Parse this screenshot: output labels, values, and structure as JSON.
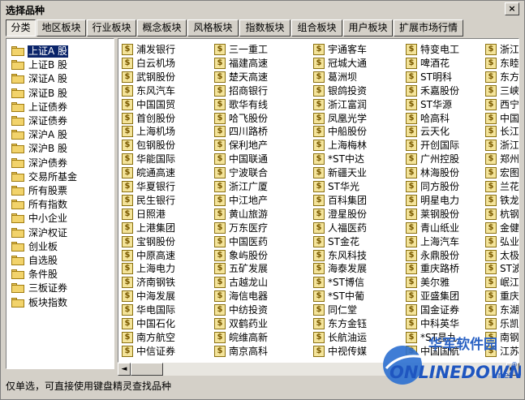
{
  "window": {
    "title": "选择品种",
    "close_label": "×"
  },
  "tabs": [
    "分类",
    "地区板块",
    "行业板块",
    "概念板块",
    "风格板块",
    "指数板块",
    "组合板块",
    "用户板块",
    "扩展市场行情"
  ],
  "tree": {
    "selected_index": 0,
    "items": [
      "上证A 股",
      "上证B 股",
      "深证A 股",
      "深证B 股",
      "上证债券",
      "深证债券",
      "深沪A 股",
      "深沪B 股",
      "深沪债券",
      "交易所基金",
      "所有股票",
      "所有指数",
      "中小企业",
      "深沪权证",
      "创业板",
      "自选股",
      "条件股",
      "三板证券",
      "板块指数"
    ]
  },
  "stock_icon": "dollar-coin-icon",
  "stock_icon_glyph": "$",
  "grid": {
    "columns": [
      [
        "浦发银行",
        "白云机场",
        "武钢股份",
        "东风汽车",
        "中国国贸",
        "首创股份",
        "上海机场",
        "包钢股份",
        "华能国际",
        "皖通高速",
        "华夏银行",
        "民生银行",
        "日照港",
        "上港集团",
        "宝钢股份",
        "中原高速",
        "上海电力",
        "济南钢铁",
        "中海发展",
        "华电国际",
        "中国石化",
        "南方航空",
        "中信证券"
      ],
      [
        "三一重工",
        "福建高速",
        "楚天高速",
        "招商银行",
        "歌华有线",
        "哈飞股份",
        "四川路桥",
        "保利地产",
        "中国联通",
        "宁波联合",
        "浙江广厦",
        "中江地产",
        "黄山旅游",
        "万东医疗",
        "中国医药",
        "象屿股份",
        "五矿发展",
        "古越龙山",
        "海信电器",
        "中纺投资",
        "双鹤药业",
        "皖维高新",
        "南京高科"
      ],
      [
        "宇通客车",
        "冠城大通",
        "葛洲坝",
        "银鸽投资",
        "浙江富润",
        "凤凰光学",
        "中船股份",
        "上海梅林",
        "*ST中达",
        "新疆天业",
        "ST华光",
        "百科集团",
        "澄星股份",
        "人福医药",
        "ST金花",
        "东风科技",
        "海泰发展",
        "*ST博信",
        "*ST中葡",
        "同仁堂",
        "东方金钰",
        "长航油运",
        "中视传媒"
      ],
      [
        "特变电工",
        "啤酒花",
        "ST明科",
        "禾嘉股份",
        "ST华源",
        "哈高科",
        "云天化",
        "开创国际",
        "广州控股",
        "林海股份",
        "同方股份",
        "明星电力",
        "莱钢股份",
        "青山纸业",
        "上海汽车",
        "永鼎股份",
        "重庆路桥",
        "美尔雅",
        "亚盛集团",
        "国金证券",
        "中科英华",
        "*ST昌九",
        "中国国航"
      ],
      [
        "浙江",
        "东睦",
        "东方",
        "三峡",
        "西宁",
        "中国",
        "长江",
        "浙江",
        "郑州",
        "宏图",
        "兰花",
        "铁龙",
        "杭钢",
        "金健",
        "弘业",
        "太极",
        "ST波",
        "岷江",
        "重庆",
        "东湖",
        "乐凯",
        "南钢",
        "江苏"
      ]
    ]
  },
  "scrollbar": {
    "left_arrow": "◄",
    "right_arrow": "►"
  },
  "status": {
    "text": "仅单选，可直接使用键盘精灵查找品种"
  },
  "watermark": {
    "cn": "华军软件园",
    "en": "ONLINEDOWN",
    "suffix": ".net",
    "registered": "®"
  }
}
